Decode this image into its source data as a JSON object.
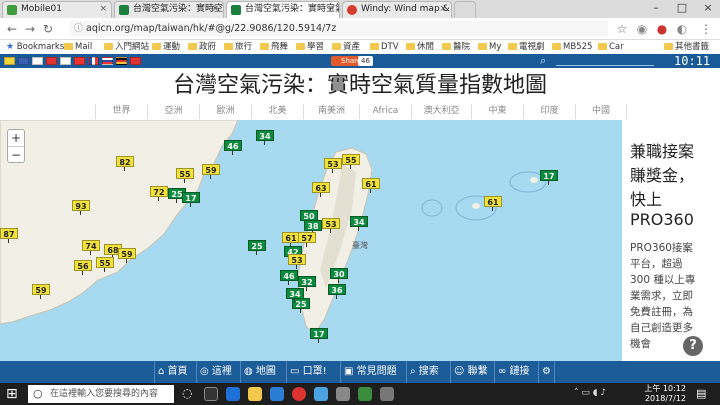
{
  "browser": {
    "tabs": [
      {
        "label": "Mobile01",
        "color": "#3f9b3b",
        "active": false
      },
      {
        "label": "台灣空氣污染：實時空氣",
        "color": "#1b7f3e",
        "active": false
      },
      {
        "label": "台灣空氣污染：實時空氣",
        "color": "#1b7f3e",
        "active": true
      },
      {
        "label": "Windy: Wind map & we",
        "color": "#d33b2c",
        "active": false
      }
    ],
    "url": "aqicn.org/map/taiwan/hk/#@g/22.9086/120.5914/7z",
    "bookmarks": [
      "Bookmarks",
      "Mail",
      "入門網站",
      "運動",
      "政府",
      "旅行",
      "飛舞",
      "學習",
      "資產",
      "DTV",
      "休閒",
      "醫院",
      "My",
      "電視劇",
      "MB525",
      "Car",
      "其他書籤"
    ]
  },
  "site": {
    "share_label": "Share",
    "share_count": "46",
    "clock": "10:11",
    "title": "台灣空氣污染：實時空氣質量指數地圖",
    "regions": [
      "世界",
      "亞洲",
      "歐洲",
      "北美",
      "南美洲",
      "Africa",
      "澳大利亞",
      "中東",
      "印度",
      "中國"
    ]
  },
  "map": {
    "zoom_in": "+",
    "zoom_out": "−",
    "land_labels": [
      "臺灣"
    ],
    "markers": [
      {
        "v": "46",
        "c": "g"
      },
      {
        "v": "34",
        "c": "g"
      },
      {
        "v": "82",
        "c": "y"
      },
      {
        "v": "55",
        "c": "y"
      },
      {
        "v": "59",
        "c": "y"
      },
      {
        "v": "72",
        "c": "y"
      },
      {
        "v": "25",
        "c": "g"
      },
      {
        "v": "17",
        "c": "g"
      },
      {
        "v": "93",
        "c": "y"
      },
      {
        "v": "87",
        "c": "y"
      },
      {
        "v": "74",
        "c": "y"
      },
      {
        "v": "68",
        "c": "y"
      },
      {
        "v": "59",
        "c": "y"
      },
      {
        "v": "55",
        "c": "y"
      },
      {
        "v": "56",
        "c": "y"
      },
      {
        "v": "59",
        "c": "y"
      },
      {
        "v": "25",
        "c": "g"
      },
      {
        "v": "53",
        "c": "y"
      },
      {
        "v": "55",
        "c": "y"
      },
      {
        "v": "61",
        "c": "y"
      },
      {
        "v": "63",
        "c": "y"
      },
      {
        "v": "34",
        "c": "g"
      },
      {
        "v": "50",
        "c": "g"
      },
      {
        "v": "38",
        "c": "g"
      },
      {
        "v": "53",
        "c": "y"
      },
      {
        "v": "61",
        "c": "y"
      },
      {
        "v": "57",
        "c": "y"
      },
      {
        "v": "42",
        "c": "g"
      },
      {
        "v": "53",
        "c": "y"
      },
      {
        "v": "46",
        "c": "g"
      },
      {
        "v": "32",
        "c": "g"
      },
      {
        "v": "25",
        "c": "g"
      },
      {
        "v": "30",
        "c": "g"
      },
      {
        "v": "36",
        "c": "g"
      },
      {
        "v": "34",
        "c": "g"
      },
      {
        "v": "17",
        "c": "g"
      },
      {
        "v": "61",
        "c": "y"
      },
      {
        "v": "17",
        "c": "g"
      }
    ]
  },
  "ad": {
    "lines_big": [
      "兼職接案",
      "賺獎金，",
      "快上",
      "PRO360"
    ],
    "lines_small": [
      "PRO360接案",
      "平台，超過",
      "300 種以上專",
      "業需求，立即",
      "免費註冊，為",
      "自己創造更多",
      "機會"
    ],
    "help": "?"
  },
  "nav": [
    "首頁",
    "這裡",
    "地圖",
    "口罩!",
    "常見問題",
    "搜索",
    "聯繫",
    "鏈接"
  ],
  "taskbar": {
    "search_placeholder": "在這裡輸入您要搜尋的內容",
    "time": "上午 10:12",
    "date": "2018/7/12"
  },
  "colors": {
    "site_blue": "#1a5a98",
    "sea": "#a7d9f0",
    "good": "#0b8b3e",
    "moderate": "#f3e23c"
  }
}
